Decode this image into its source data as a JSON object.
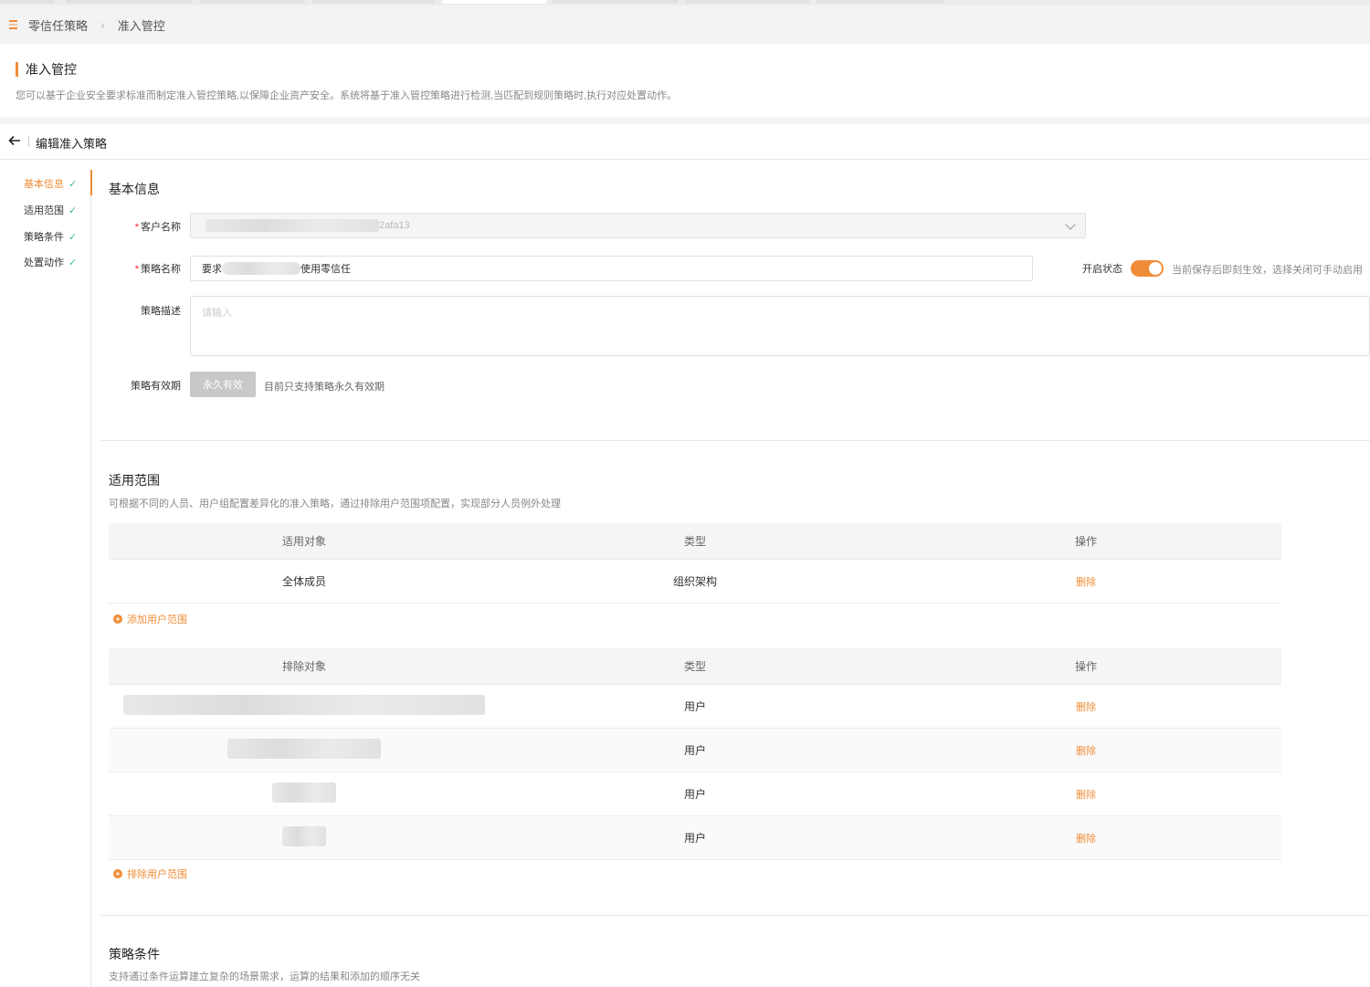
{
  "breadcrumb": {
    "items": [
      "零信任策略",
      "准入管控"
    ]
  },
  "header": {
    "title": "准入管控",
    "description": "您可以基于企业安全要求标准而制定准入管控策略,以保障企业资产安全。系统将基于准入管控策略进行检测,当匹配到规则策略时,执行对应处置动作。"
  },
  "page": {
    "title": "编辑准入策略"
  },
  "steps": [
    {
      "label": "基本信息",
      "check": "✓"
    },
    {
      "label": "适用范围",
      "check": "✓"
    },
    {
      "label": "策略条件",
      "check": "✓"
    },
    {
      "label": "处置动作",
      "check": "✓"
    }
  ],
  "basic": {
    "title": "基本信息",
    "customer_label": "客户名称",
    "customer_value_suffix": "2afa13",
    "name_label": "策略名称",
    "name_prefix": "要求",
    "name_suffix": "使用零信任",
    "status_label": "开启状态",
    "status_on": true,
    "status_hint": "当前保存后即刻生效，选择关闭可手动启用",
    "desc_label": "策略描述",
    "desc_placeholder": "请输入",
    "validity_label": "策略有效期",
    "validity_button": "永久有效",
    "validity_hint": "目前只支持策略永久有效期"
  },
  "scope": {
    "title": "适用范围",
    "description": "可根据不同的人员、用户组配置差异化的准入策略，通过排除用户范围项配置，实现部分人员例外处理",
    "include_headers": [
      "适用对象",
      "类型",
      "操作"
    ],
    "include_rows": [
      {
        "target": "全体成员",
        "type": "组织架构",
        "action": "删除"
      }
    ],
    "add_include": "添加用户范围",
    "exclude_headers": [
      "排除对象",
      "类型",
      "操作"
    ],
    "exclude_rows": [
      {
        "type": "用户",
        "action": "删除"
      },
      {
        "type": "用户",
        "action": "删除"
      },
      {
        "type": "用户",
        "action": "删除"
      },
      {
        "type": "用户",
        "action": "删除"
      }
    ],
    "add_exclude": "排除用户范围"
  },
  "conditions": {
    "title": "策略条件",
    "description": "支持通过条件运算建立复杂的场景需求，运算的结果和添加的顺序无关"
  },
  "colors": {
    "accent": "#f08c37",
    "check": "#3cbf8a",
    "required": "#f5222d"
  }
}
